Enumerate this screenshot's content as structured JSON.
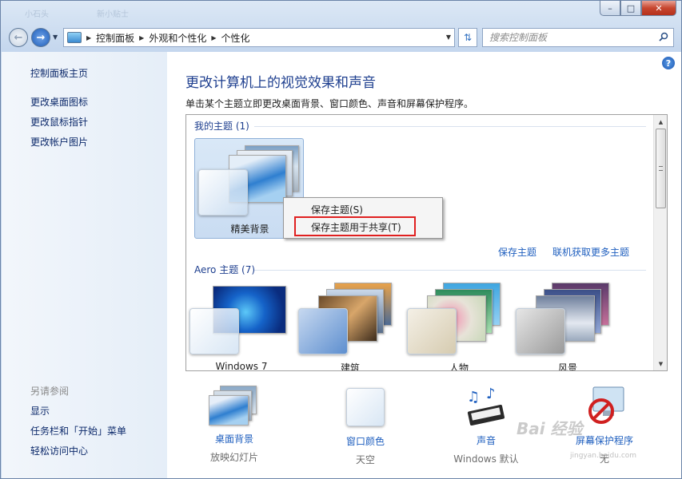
{
  "window": {
    "ghost_tab_1": "小石头",
    "ghost_tab_2": "新小贴士",
    "minimize": "–",
    "maximize": "□",
    "close": "✕"
  },
  "address": {
    "crumbs": [
      "控制面板",
      "外观和个性化",
      "个性化"
    ],
    "search_placeholder": "搜索控制面板"
  },
  "sidebar": {
    "home": "控制面板主页",
    "links": [
      "更改桌面图标",
      "更改鼠标指针",
      "更改帐户图片"
    ],
    "see_also_title": "另请参阅",
    "see_also": [
      "显示",
      "任务栏和「开始」菜单",
      "轻松访问中心"
    ]
  },
  "main": {
    "title": "更改计算机上的视觉效果和声音",
    "description": "单击某个主题立即更改桌面背景、窗口颜色、声音和屏幕保护程序。",
    "help_icon": "?",
    "my_themes_label": "我的主题 (1)",
    "my_theme_name": "精美背景",
    "save_theme_link": "保存主题",
    "online_themes_link": "联机获取更多主题",
    "aero_label": "Aero 主题 (7)",
    "aero_themes": [
      "Windows 7",
      "建筑",
      "人物",
      "风景"
    ]
  },
  "context_menu": {
    "item_save": "保存主题(S)",
    "item_save_share": "保存主题用于共享(T)"
  },
  "bottom_bar": {
    "items": [
      {
        "label": "桌面背景",
        "sub": "放映幻灯片"
      },
      {
        "label": "窗口颜色",
        "sub": "天空"
      },
      {
        "label": "声音",
        "sub": "Windows 默认"
      },
      {
        "label": "屏幕保护程序",
        "sub": "无"
      }
    ]
  },
  "watermark": {
    "text": "Bai 经验",
    "sub": "jingyan.baidu.com"
  }
}
